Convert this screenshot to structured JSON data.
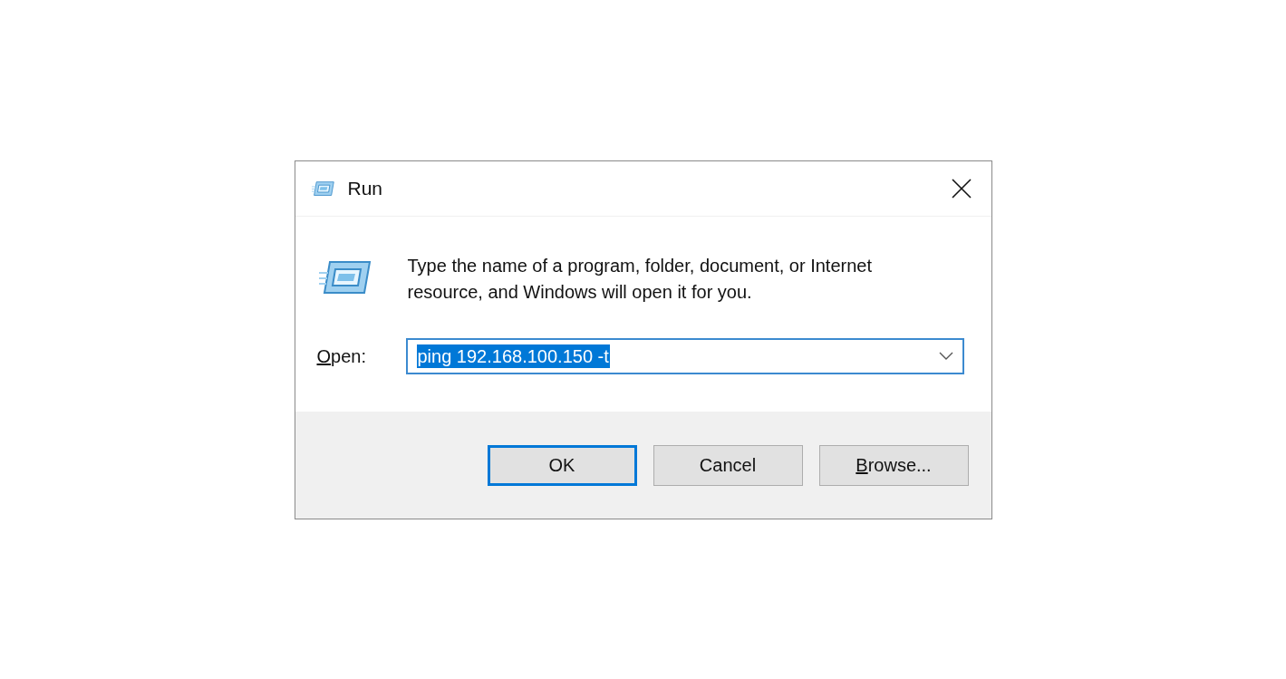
{
  "window": {
    "title": "Run"
  },
  "message": "Type the name of a program, folder, document, or Internet resource, and Windows will open it for you.",
  "open_field": {
    "label": "Open:",
    "label_underline_first": true,
    "value": "ping 192.168.100.150 -t",
    "text_selected": true
  },
  "buttons": [
    {
      "label": "OK",
      "default": true,
      "underline_first": false
    },
    {
      "label": "Cancel",
      "default": false,
      "underline_first": false
    },
    {
      "label": "Browse...",
      "default": false,
      "underline_first": true
    }
  ]
}
